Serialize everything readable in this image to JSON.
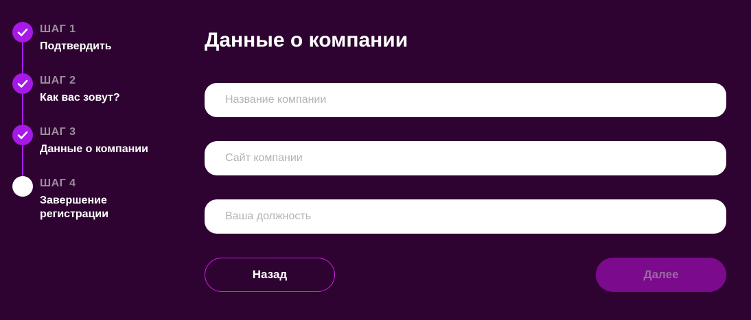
{
  "stepper": {
    "steps": [
      {
        "number": "ШАГ 1",
        "title_lines": [
          "Подтвердить"
        ],
        "status": "done"
      },
      {
        "number": "ШАГ 2",
        "title_lines": [
          "Как вас зовут?"
        ],
        "status": "done"
      },
      {
        "number": "ШАГ 3",
        "title_lines": [
          "Данные о компании"
        ],
        "status": "done"
      },
      {
        "number": "ШАГ 4",
        "title_lines": [
          "Завершение",
          "регистрации"
        ],
        "status": "pending"
      }
    ]
  },
  "form": {
    "title": "Данные о компании",
    "fields": [
      {
        "placeholder": "Название компании",
        "value": ""
      },
      {
        "placeholder": "Сайт компании",
        "value": ""
      },
      {
        "placeholder": "Ваша должность",
        "value": ""
      }
    ],
    "back_label": "Назад",
    "next_label": "Далее"
  },
  "colors": {
    "background": "#2e0331",
    "accent": "#a719e8",
    "back_border": "#d11fe0",
    "next_button": "#7b0a8c",
    "step_number": "#9c8f9d"
  },
  "icons": {
    "step_done": "check-icon",
    "step_pending": "empty-circle-icon"
  }
}
